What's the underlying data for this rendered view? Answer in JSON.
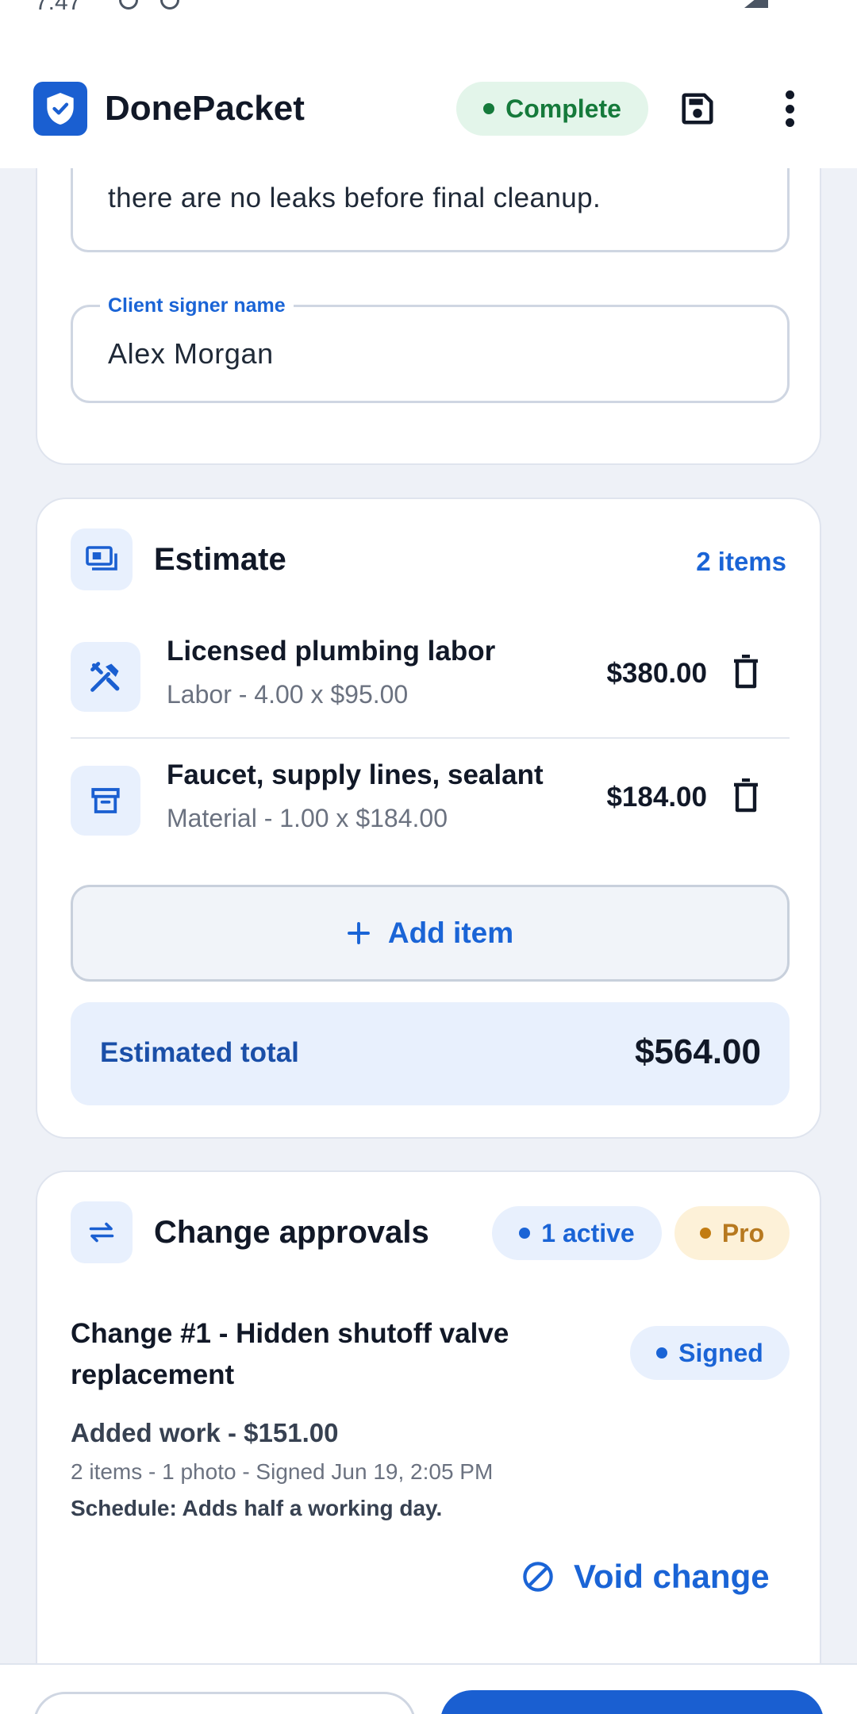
{
  "status_bar": {
    "time": "7:47"
  },
  "app": {
    "title": "DonePacket",
    "status": "Complete",
    "save_icon": "save-icon",
    "more_icon": "more-vertical-icon",
    "accent": "#1a5fd1"
  },
  "notes": {
    "visible_line": "there are no leaks before final cleanup."
  },
  "signer": {
    "label": "Client signer name",
    "value": "Alex Morgan"
  },
  "estimate": {
    "title": "Estimate",
    "count": "2 items",
    "items": [
      {
        "name": "Licensed plumbing labor",
        "detail": "Labor - 4.00 x $95.00",
        "price": "$380.00",
        "icon": "tools-icon"
      },
      {
        "name": "Faucet, supply lines, sealant",
        "detail": "Material - 1.00 x $184.00",
        "price": "$184.00",
        "icon": "archive-box-icon"
      }
    ],
    "add_label": "Add item",
    "total_label": "Estimated total",
    "total_value": "$564.00"
  },
  "changes": {
    "title": "Change approvals",
    "active_badge": "1 active",
    "pro_badge": "Pro",
    "item": {
      "title": "Change #1 - Hidden shutoff valve replacement",
      "status": "Signed",
      "amount": "Added work - $151.00",
      "meta": "2 items - 1 photo - Signed Jun 19, 2:05 PM",
      "schedule": "Schedule: Adds half a working day."
    },
    "void_label": "Void change"
  }
}
